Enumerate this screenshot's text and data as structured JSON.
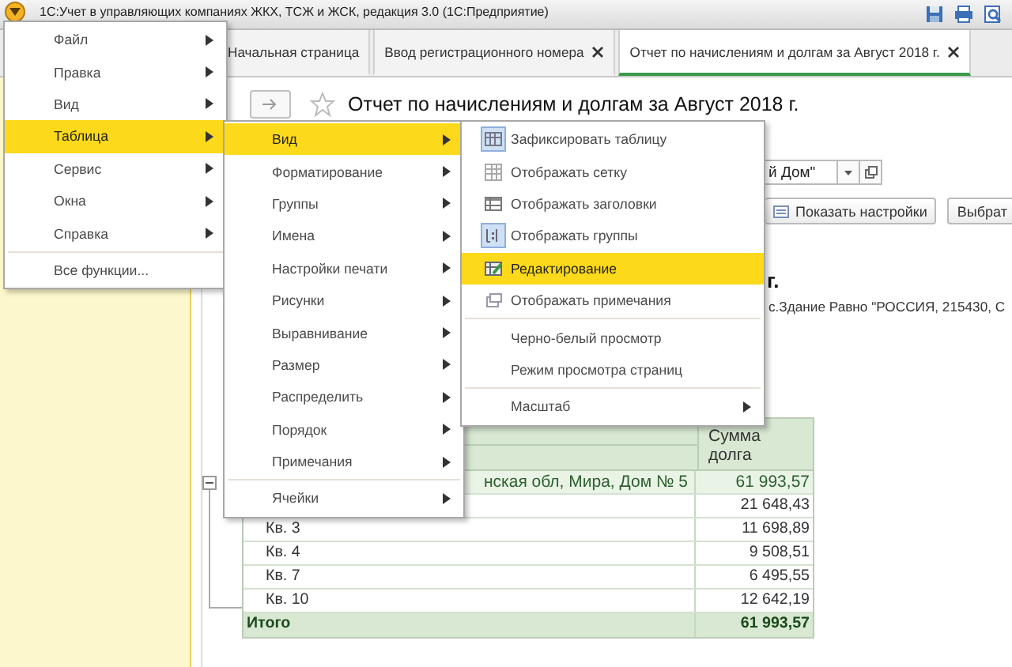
{
  "window": {
    "title": "1С:Учет в управляющих компаниях ЖКХ, ТСЖ и ЖСК, редакция 3.0  (1С:Предприятие)"
  },
  "tabs": [
    {
      "label": "Начальная страница",
      "selected": false,
      "closable": false
    },
    {
      "label": "Ввод регистрационного номера",
      "selected": false,
      "closable": true
    },
    {
      "label": "Отчет по начислениям и долгам за Август 2018 г.",
      "selected": true,
      "closable": true
    }
  ],
  "page": {
    "title": "Отчет по начислениям и долгам за Август 2018 г.",
    "field_value": "й Дом\"",
    "buttons": [
      {
        "label": "Показать настройки",
        "kind": "settings"
      },
      {
        "label": "Выбрат",
        "kind": "plain"
      }
    ]
  },
  "report": {
    "heading": "г.",
    "subtitle": "с.Здание Равно \"РОССИЯ, 215430, С"
  },
  "table": {
    "value_header": "Сумма долга",
    "rows": [
      {
        "kind": "group",
        "label": "нская обл, Мира, Дом № 5",
        "value": "61 993,57"
      },
      {
        "kind": "item",
        "value": "21 648,43"
      },
      {
        "kind": "item",
        "label": "Кв. 3",
        "value": "11 698,89"
      },
      {
        "kind": "item",
        "label": "Кв. 4",
        "value": "9 508,51"
      },
      {
        "kind": "item",
        "label": "Кв. 7",
        "value": "6 495,55"
      },
      {
        "kind": "item",
        "label": "Кв. 10",
        "value": "12 642,19"
      },
      {
        "kind": "total",
        "label": "Итого",
        "value": "61 993,57"
      }
    ]
  },
  "main_menu": [
    {
      "label": "Файл",
      "selected": false,
      "submenu": true
    },
    {
      "label": "Правка",
      "selected": false,
      "submenu": true
    },
    {
      "label": "Вид",
      "selected": false,
      "submenu": true
    },
    {
      "label": "Таблица",
      "selected": true,
      "submenu": true
    },
    {
      "label": "Сервис",
      "selected": false,
      "submenu": true
    },
    {
      "label": "Окна",
      "selected": false,
      "submenu": true
    },
    {
      "label": "Справка",
      "selected": false,
      "submenu": true
    },
    {
      "label": "Все функции...",
      "selected": false,
      "submenu": false,
      "separator_before": true
    }
  ],
  "table_menu": [
    {
      "label": "Вид",
      "selected": true
    },
    {
      "label": "Форматирование",
      "selected": false
    },
    {
      "label": "Группы",
      "selected": false
    },
    {
      "label": "Имена",
      "selected": false
    },
    {
      "label": "Настройки печати",
      "selected": false
    },
    {
      "label": "Рисунки",
      "selected": false
    },
    {
      "label": "Выравнивание",
      "selected": false
    },
    {
      "label": "Размер",
      "selected": false
    },
    {
      "label": "Распределить",
      "selected": false
    },
    {
      "label": "Порядок",
      "selected": false
    },
    {
      "label": "Примечания",
      "selected": false
    },
    {
      "label": "Ячейки",
      "selected": false,
      "separator_before": true
    }
  ],
  "view_menu": [
    {
      "label": "Зафиксировать таблицу",
      "kind": "freeze",
      "checked": true,
      "selected": false,
      "submenu": false
    },
    {
      "label": "Отображать сетку",
      "kind": "grid",
      "checked": false,
      "selected": false,
      "submenu": false
    },
    {
      "label": "Отображать заголовки",
      "kind": "headers",
      "checked": false,
      "selected": false,
      "submenu": false
    },
    {
      "label": "Отображать группы",
      "kind": "groups",
      "checked": true,
      "selected": false,
      "submenu": false
    },
    {
      "label": "Редактирование",
      "kind": "edit",
      "checked": false,
      "selected": true,
      "submenu": false
    },
    {
      "label": "Отображать примечания",
      "kind": "notes",
      "checked": false,
      "selected": false,
      "submenu": false
    },
    {
      "label": "Черно-белый просмотр",
      "kind": "text",
      "selected": false,
      "submenu": false,
      "separator_before": true
    },
    {
      "label": "Режим просмотра страниц",
      "kind": "text",
      "selected": false,
      "submenu": false
    },
    {
      "label": "Масштаб",
      "kind": "text",
      "selected": false,
      "submenu": true,
      "separator_before": true
    }
  ]
}
